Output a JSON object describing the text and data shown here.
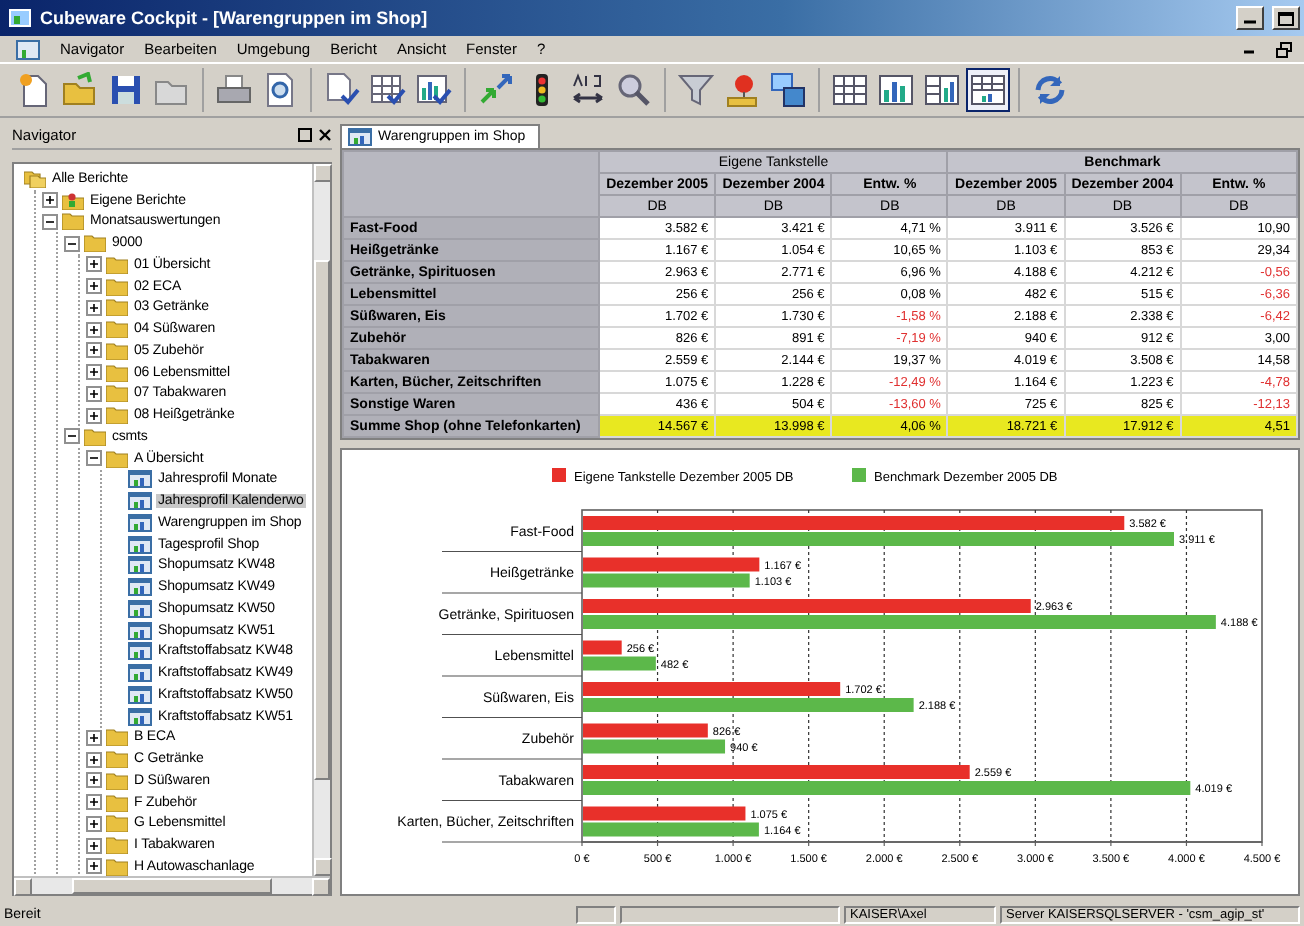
{
  "window": {
    "title": "Cubeware Cockpit - [Warengruppen im Shop]"
  },
  "menu": [
    "Navigator",
    "Bearbeiten",
    "Umgebung",
    "Bericht",
    "Ansicht",
    "Fenster",
    "?"
  ],
  "toolbar_groups": [
    [
      {
        "kind": "new-report",
        "pressed": false
      },
      {
        "kind": "open-folder",
        "pressed": false
      },
      {
        "kind": "save",
        "pressed": false
      },
      {
        "kind": "gray-folder",
        "pressed": false
      }
    ],
    [
      {
        "kind": "print",
        "pressed": false
      },
      {
        "kind": "print-preview",
        "pressed": false
      }
    ],
    [
      {
        "kind": "document-check",
        "pressed": false
      },
      {
        "kind": "table-check",
        "pressed": false
      },
      {
        "kind": "chart-check",
        "pressed": false
      }
    ],
    [
      {
        "kind": "arrows",
        "pressed": false
      },
      {
        "kind": "traffic-light",
        "pressed": false
      },
      {
        "kind": "text-swap",
        "pressed": false
      },
      {
        "kind": "magnifier",
        "pressed": false
      }
    ],
    [
      {
        "kind": "filter",
        "pressed": false
      },
      {
        "kind": "pin",
        "pressed": false
      },
      {
        "kind": "windows",
        "pressed": false
      }
    ],
    [
      {
        "kind": "grid",
        "pressed": false
      },
      {
        "kind": "bar-chart",
        "pressed": false
      },
      {
        "kind": "table-bars",
        "pressed": false
      },
      {
        "kind": "table-chart",
        "pressed": true
      }
    ],
    [
      {
        "kind": "refresh",
        "pressed": false
      }
    ]
  ],
  "navigator": {
    "title": "Navigator",
    "tree": [
      {
        "label": "Alle Berichte",
        "kind": "root",
        "selected": false,
        "children": [
          {
            "label": "Eigene Berichte",
            "kind": "personal",
            "selected": false,
            "expanded": false
          },
          {
            "label": "Monatsauswertungen",
            "kind": "folder",
            "selected": false,
            "expanded": true,
            "children": [
              {
                "label": "9000",
                "kind": "folder",
                "selected": false,
                "expanded": true,
                "children": [
                  {
                    "label": "01 Übersicht",
                    "kind": "folder",
                    "selected": false,
                    "expanded": false
                  },
                  {
                    "label": "02 ECA",
                    "kind": "folder",
                    "selected": false,
                    "expanded": false
                  },
                  {
                    "label": "03 Getränke",
                    "kind": "folder",
                    "selected": false,
                    "expanded": false
                  },
                  {
                    "label": "04 Süßwaren",
                    "kind": "folder",
                    "selected": false,
                    "expanded": false
                  },
                  {
                    "label": "05 Zubehör",
                    "kind": "folder",
                    "selected": false,
                    "expanded": false
                  },
                  {
                    "label": "06 Lebensmittel",
                    "kind": "folder",
                    "selected": false,
                    "expanded": false
                  },
                  {
                    "label": "07 Tabakwaren",
                    "kind": "folder",
                    "selected": false,
                    "expanded": false
                  },
                  {
                    "label": "08 Heißgetränke",
                    "kind": "folder",
                    "selected": false,
                    "expanded": false
                  }
                ]
              },
              {
                "label": "csmts",
                "kind": "folder",
                "selected": false,
                "expanded": true,
                "children": [
                  {
                    "label": "A Übersicht",
                    "kind": "folder",
                    "selected": false,
                    "expanded": true,
                    "children": [
                      {
                        "label": "Jahresprofil Monate",
                        "kind": "report",
                        "selected": false
                      },
                      {
                        "label": "Jahresprofil Kalenderwo",
                        "kind": "report",
                        "selected": true
                      },
                      {
                        "label": "Warengruppen im Shop",
                        "kind": "report",
                        "selected": false
                      },
                      {
                        "label": "Tagesprofil Shop",
                        "kind": "report",
                        "selected": false
                      },
                      {
                        "label": "Shopumsatz KW48",
                        "kind": "report",
                        "selected": false
                      },
                      {
                        "label": "Shopumsatz KW49",
                        "kind": "report",
                        "selected": false
                      },
                      {
                        "label": "Shopumsatz KW50",
                        "kind": "report",
                        "selected": false
                      },
                      {
                        "label": "Shopumsatz KW51",
                        "kind": "report",
                        "selected": false
                      },
                      {
                        "label": "Kraftstoffabsatz KW48",
                        "kind": "report",
                        "selected": false
                      },
                      {
                        "label": "Kraftstoffabsatz KW49",
                        "kind": "report",
                        "selected": false
                      },
                      {
                        "label": "Kraftstoffabsatz KW50",
                        "kind": "report",
                        "selected": false
                      },
                      {
                        "label": "Kraftstoffabsatz KW51",
                        "kind": "report",
                        "selected": false
                      }
                    ]
                  },
                  {
                    "label": "B ECA",
                    "kind": "folder",
                    "selected": false,
                    "expanded": false
                  },
                  {
                    "label": "C Getränke",
                    "kind": "folder",
                    "selected": false,
                    "expanded": false
                  },
                  {
                    "label": "D Süßwaren",
                    "kind": "folder",
                    "selected": false,
                    "expanded": false
                  },
                  {
                    "label": "F Zubehör",
                    "kind": "folder",
                    "selected": false,
                    "expanded": false
                  },
                  {
                    "label": "G Lebensmittel",
                    "kind": "folder",
                    "selected": false,
                    "expanded": false
                  },
                  {
                    "label": "I Tabakwaren",
                    "kind": "folder",
                    "selected": false,
                    "expanded": false
                  },
                  {
                    "label": "H Autowaschanlage",
                    "kind": "folder",
                    "selected": false,
                    "expanded": false
                  }
                ]
              }
            ]
          }
        ]
      }
    ]
  },
  "tabs": [
    {
      "label": "Warengruppen im Shop",
      "selected": true
    }
  ],
  "table": {
    "groups": [
      {
        "label": "Eigene Tankstelle",
        "emphasized": false
      },
      {
        "label": "Benchmark",
        "emphasized": true
      }
    ],
    "columns": [
      {
        "label": "Dezember 2005",
        "unit": "DB"
      },
      {
        "label": "Dezember 2004",
        "unit": "DB"
      },
      {
        "label": "Entw. %",
        "unit": "DB"
      },
      {
        "label": "Dezember 2005",
        "unit": "DB"
      },
      {
        "label": "Dezember 2004",
        "unit": "DB"
      },
      {
        "label": "Entw. %",
        "unit": "DB"
      }
    ],
    "rows": [
      {
        "label": "Fast-Food",
        "highlighted": false,
        "cells": [
          {
            "text": "3.582 €",
            "negative": false
          },
          {
            "text": "3.421 €",
            "negative": false
          },
          {
            "text": "4,71 %",
            "negative": false
          },
          {
            "text": "3.911 €",
            "negative": false
          },
          {
            "text": "3.526 €",
            "negative": false
          },
          {
            "text": "10,90",
            "negative": false
          }
        ]
      },
      {
        "label": "Heißgetränke",
        "highlighted": false,
        "cells": [
          {
            "text": "1.167 €",
            "negative": false
          },
          {
            "text": "1.054 €",
            "negative": false
          },
          {
            "text": "10,65 %",
            "negative": false
          },
          {
            "text": "1.103 €",
            "negative": false
          },
          {
            "text": "853 €",
            "negative": false
          },
          {
            "text": "29,34",
            "negative": false
          }
        ]
      },
      {
        "label": "Getränke, Spirituosen",
        "highlighted": false,
        "cells": [
          {
            "text": "2.963 €",
            "negative": false
          },
          {
            "text": "2.771 €",
            "negative": false
          },
          {
            "text": "6,96 %",
            "negative": false
          },
          {
            "text": "4.188 €",
            "negative": false
          },
          {
            "text": "4.212 €",
            "negative": false
          },
          {
            "text": "-0,56",
            "negative": true
          }
        ]
      },
      {
        "label": "Lebensmittel",
        "highlighted": false,
        "cells": [
          {
            "text": "256 €",
            "negative": false
          },
          {
            "text": "256 €",
            "negative": false
          },
          {
            "text": "0,08 %",
            "negative": false
          },
          {
            "text": "482 €",
            "negative": false
          },
          {
            "text": "515 €",
            "negative": false
          },
          {
            "text": "-6,36",
            "negative": true
          }
        ]
      },
      {
        "label": "Süßwaren, Eis",
        "highlighted": false,
        "cells": [
          {
            "text": "1.702 €",
            "negative": false
          },
          {
            "text": "1.730 €",
            "negative": false
          },
          {
            "text": "-1,58 %",
            "negative": true
          },
          {
            "text": "2.188 €",
            "negative": false
          },
          {
            "text": "2.338 €",
            "negative": false
          },
          {
            "text": "-6,42",
            "negative": true
          }
        ]
      },
      {
        "label": "Zubehör",
        "highlighted": false,
        "cells": [
          {
            "text": "826 €",
            "negative": false
          },
          {
            "text": "891 €",
            "negative": false
          },
          {
            "text": "-7,19 %",
            "negative": true
          },
          {
            "text": "940 €",
            "negative": false
          },
          {
            "text": "912 €",
            "negative": false
          },
          {
            "text": "3,00",
            "negative": false
          }
        ]
      },
      {
        "label": "Tabakwaren",
        "highlighted": false,
        "cells": [
          {
            "text": "2.559 €",
            "negative": false
          },
          {
            "text": "2.144 €",
            "negative": false
          },
          {
            "text": "19,37 %",
            "negative": false
          },
          {
            "text": "4.019 €",
            "negative": false
          },
          {
            "text": "3.508 €",
            "negative": false
          },
          {
            "text": "14,58",
            "negative": false
          }
        ]
      },
      {
        "label": "Karten, Bücher, Zeitschriften",
        "highlighted": false,
        "cells": [
          {
            "text": "1.075 €",
            "negative": false
          },
          {
            "text": "1.228 €",
            "negative": false
          },
          {
            "text": "-12,49 %",
            "negative": true
          },
          {
            "text": "1.164 €",
            "negative": false
          },
          {
            "text": "1.223 €",
            "negative": false
          },
          {
            "text": "-4,78",
            "negative": true
          }
        ]
      },
      {
        "label": "Sonstige Waren",
        "highlighted": false,
        "cells": [
          {
            "text": "436 €",
            "negative": false
          },
          {
            "text": "504 €",
            "negative": false
          },
          {
            "text": "-13,60 %",
            "negative": true
          },
          {
            "text": "725 €",
            "negative": false
          },
          {
            "text": "825 €",
            "negative": false
          },
          {
            "text": "-12,13",
            "negative": true
          }
        ]
      },
      {
        "label": "Summe Shop (ohne Telefonkarten)",
        "highlighted": true,
        "cells": [
          {
            "text": "14.567 €",
            "negative": false
          },
          {
            "text": "13.998 €",
            "negative": false
          },
          {
            "text": "4,06 %",
            "negative": false
          },
          {
            "text": "18.721 €",
            "negative": false
          },
          {
            "text": "17.912 €",
            "negative": false
          },
          {
            "text": "4,51",
            "negative": false
          }
        ]
      }
    ]
  },
  "chart": {
    "chart_data": {
      "type": "bar",
      "orientation": "horizontal",
      "categories": [
        "Fast-Food",
        "Heißgetränke",
        "Getränke, Spirituosen",
        "Lebensmittel",
        "Süßwaren, Eis",
        "Zubehör",
        "Tabakwaren",
        "Karten, Bücher, Zeitschriften"
      ],
      "series": [
        {
          "name": "Eigene Tankstelle Dezember 2005 DB",
          "color": "#e8302a",
          "values": [
            3582,
            1167,
            2963,
            256,
            1702,
            826,
            2559,
            1075
          ],
          "value_labels": [
            "3.582 €",
            "1.167 €",
            "2.963 €",
            "256 €",
            "1.702 €",
            "826 €",
            "2.559 €",
            "1.075 €"
          ]
        },
        {
          "name": "Benchmark Dezember 2005 DB",
          "color": "#5cb84a",
          "values": [
            3911,
            1103,
            4188,
            482,
            2188,
            940,
            4019,
            1164
          ],
          "value_labels": [
            "3.911 €",
            "1.103 €",
            "4.188 €",
            "482 €",
            "2.188 €",
            "940 €",
            "4.019 €",
            "1.164 €"
          ]
        }
      ],
      "xlim": [
        0,
        4500
      ],
      "xticks": [
        {
          "value": 0,
          "label": "0 €"
        },
        {
          "value": 500,
          "label": "500 €"
        },
        {
          "value": 1000,
          "label": "1.000 €"
        },
        {
          "value": 1500,
          "label": "1.500 €"
        },
        {
          "value": 2000,
          "label": "2.000 €"
        },
        {
          "value": 2500,
          "label": "2.500 €"
        },
        {
          "value": 3000,
          "label": "3.000 €"
        },
        {
          "value": 3500,
          "label": "3.500 €"
        },
        {
          "value": 4000,
          "label": "4.000 €"
        },
        {
          "value": 4500,
          "label": "4.500 €"
        }
      ],
      "data_labels": true,
      "grid": true,
      "legend": true
    }
  },
  "status_bar": {
    "message": "Bereit",
    "user": "KAISER\\Axel",
    "server": "Server KAISERSQLSERVER - 'csm_agip_st'"
  }
}
